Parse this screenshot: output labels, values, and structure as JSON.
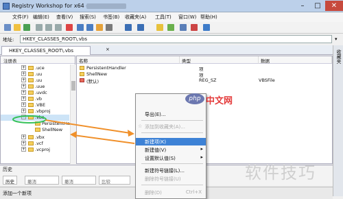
{
  "window": {
    "title": "Registry Workshop for x64 -",
    "min": "–",
    "max": "□",
    "close": "✕"
  },
  "menu": [
    "文件(F)",
    "编辑(E)",
    "查看(V)",
    "搜索(S)",
    "书签(B)",
    "收藏夹(A)",
    "工具(T)",
    "窗口(W)",
    "帮助(H)"
  ],
  "address": {
    "label": "地址:",
    "value": "HKEY_CLASSES_ROOT\\.vbs",
    "go": "▾"
  },
  "tab": {
    "label": "HKEY_CLASSES_ROOT\\.vbs",
    "close": "×"
  },
  "dock": {
    "label": "收藏夹"
  },
  "tree": {
    "header": "注册表",
    "rows": [
      {
        "label": ".uce",
        "exp": "+"
      },
      {
        "label": ".uu",
        "exp": "+"
      },
      {
        "label": ".uu",
        "exp": "+"
      },
      {
        "label": ".uue",
        "exp": "+"
      },
      {
        "label": ".uvdc",
        "exp": "+"
      },
      {
        "label": ".vb",
        "exp": "+"
      },
      {
        "label": ".VBE",
        "exp": "+"
      },
      {
        "label": ".vbproj",
        "exp": "+"
      },
      {
        "label": ".vbs",
        "exp": "–"
      }
    ],
    "children": [
      "PersistentHan",
      "ShellNew"
    ],
    "after": [
      {
        "label": ".vbx",
        "exp": "+"
      },
      {
        "label": ".vcf",
        "exp": "+"
      },
      {
        "label": ".vcproj",
        "exp": "+"
      }
    ]
  },
  "values": {
    "columns": [
      "名称",
      "类型",
      "数据"
    ],
    "rows": [
      {
        "name": "PersistentHandler",
        "type": "项",
        "data": "",
        "kind": "key"
      },
      {
        "name": "ShellNew",
        "type": "项",
        "data": "",
        "kind": "key"
      },
      {
        "name": "(默认)",
        "type": "REG_SZ",
        "data": "VBSFile",
        "kind": "value"
      }
    ]
  },
  "context_menu": {
    "items": [
      {
        "label": "导出(E)...",
        "disabled": false
      },
      {
        "label": "添加到收藏夹(A)...",
        "disabled": true,
        "star": "☆"
      },
      {
        "label": "新建项(K)",
        "disabled": false,
        "highlight": true
      },
      {
        "label": "新建值(V)",
        "disabled": false,
        "arrow": "▸"
      },
      {
        "label": "设置默认值(S)",
        "disabled": false,
        "arrow": "▸"
      },
      {
        "label": "新建符号链接(L)...",
        "disabled": false
      },
      {
        "label": "删除符号链接(U)",
        "disabled": true
      },
      {
        "label": "删除(D)",
        "disabled": true,
        "shortcut": "Ctrl+X"
      }
    ]
  },
  "history": {
    "title": "历史",
    "tabs": [
      "历史",
      "撤消",
      "撤消",
      "比较"
    ]
  },
  "status": {
    "text": "添加一个新项"
  },
  "overlays": {
    "php": "php",
    "php_brand": "中文网",
    "watermark": "软件技巧"
  },
  "colors": {
    "selection": "#3d82d6",
    "arrow": "#f0902a",
    "highlight_circle": "#35c25a"
  }
}
